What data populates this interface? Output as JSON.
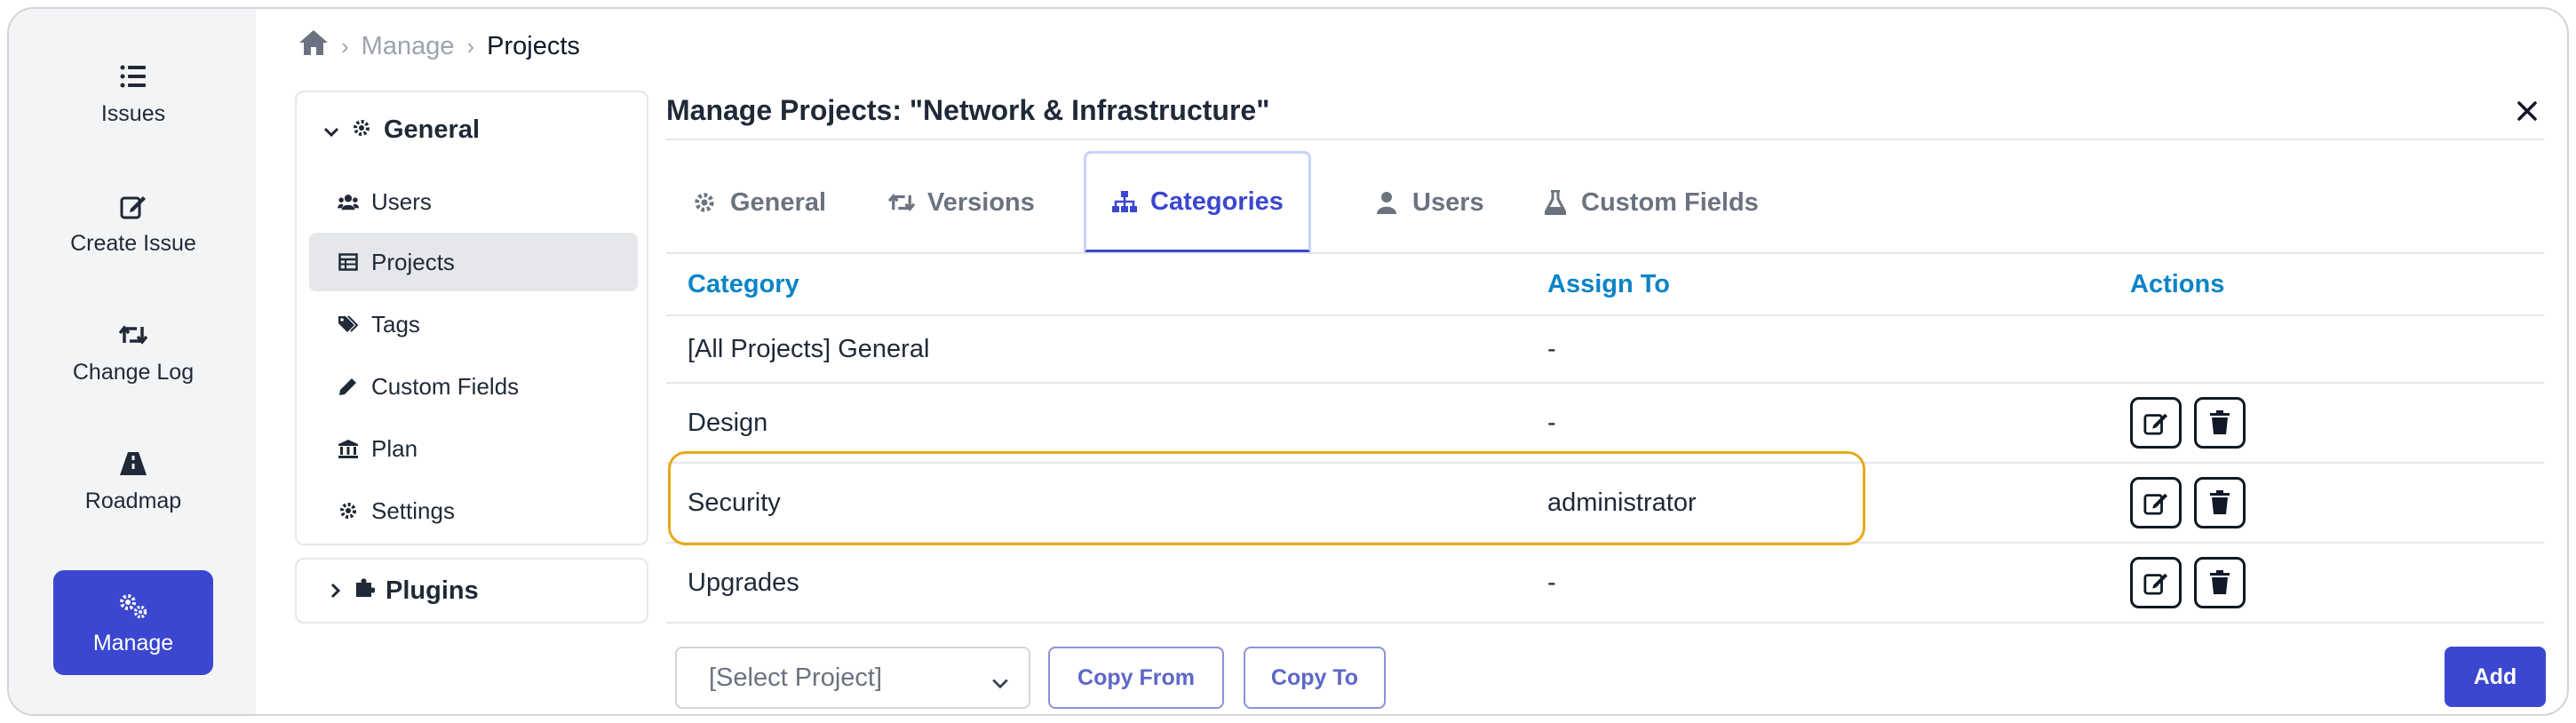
{
  "rail": {
    "items": [
      {
        "label": "Issues",
        "icon": "list-icon"
      },
      {
        "label": "Create Issue",
        "icon": "edit-icon"
      },
      {
        "label": "Change Log",
        "icon": "retweet-icon"
      },
      {
        "label": "Roadmap",
        "icon": "road-icon"
      },
      {
        "label": "Manage",
        "icon": "cogs-icon",
        "active": true
      }
    ]
  },
  "breadcrumb": {
    "home_icon": "home-icon",
    "items": [
      "Manage",
      "Projects"
    ]
  },
  "menu": {
    "section_label": "General",
    "items": [
      {
        "label": "Users",
        "icon": "users-icon"
      },
      {
        "label": "Projects",
        "icon": "table-icon",
        "active": true
      },
      {
        "label": "Tags",
        "icon": "tags-icon"
      },
      {
        "label": "Custom Fields",
        "icon": "pencil-icon"
      },
      {
        "label": "Plan",
        "icon": "bank-icon"
      },
      {
        "label": "Settings",
        "icon": "gear-icon"
      }
    ],
    "plugins_label": "Plugins"
  },
  "panel": {
    "title": "Manage Projects: \"Network & Infrastructure\"",
    "tabs": [
      {
        "label": "General",
        "icon": "gear-icon"
      },
      {
        "label": "Versions",
        "icon": "retweet-icon"
      },
      {
        "label": "Categories",
        "icon": "sitemap-icon",
        "active": true
      },
      {
        "label": "Users",
        "icon": "user-icon"
      },
      {
        "label": "Custom Fields",
        "icon": "flask-icon"
      }
    ]
  },
  "table": {
    "headers": [
      "Category",
      "Assign To",
      "Actions"
    ],
    "rows": [
      {
        "category": "[All Projects] General",
        "assign_to": "-",
        "actions": false
      },
      {
        "category": "Design",
        "assign_to": "-",
        "actions": true
      },
      {
        "category": "Security",
        "assign_to": "administrator",
        "actions": true,
        "highlighted": true
      },
      {
        "category": "Upgrades",
        "assign_to": "-",
        "actions": true
      }
    ]
  },
  "footer": {
    "select_placeholder": "[Select Project]",
    "copy_from_label": "Copy From",
    "copy_to_label": "Copy To",
    "add_label": "Add"
  },
  "colors": {
    "accent": "#3b47cf",
    "header_text": "#0b84c7",
    "highlight_border": "#e6a91a"
  }
}
